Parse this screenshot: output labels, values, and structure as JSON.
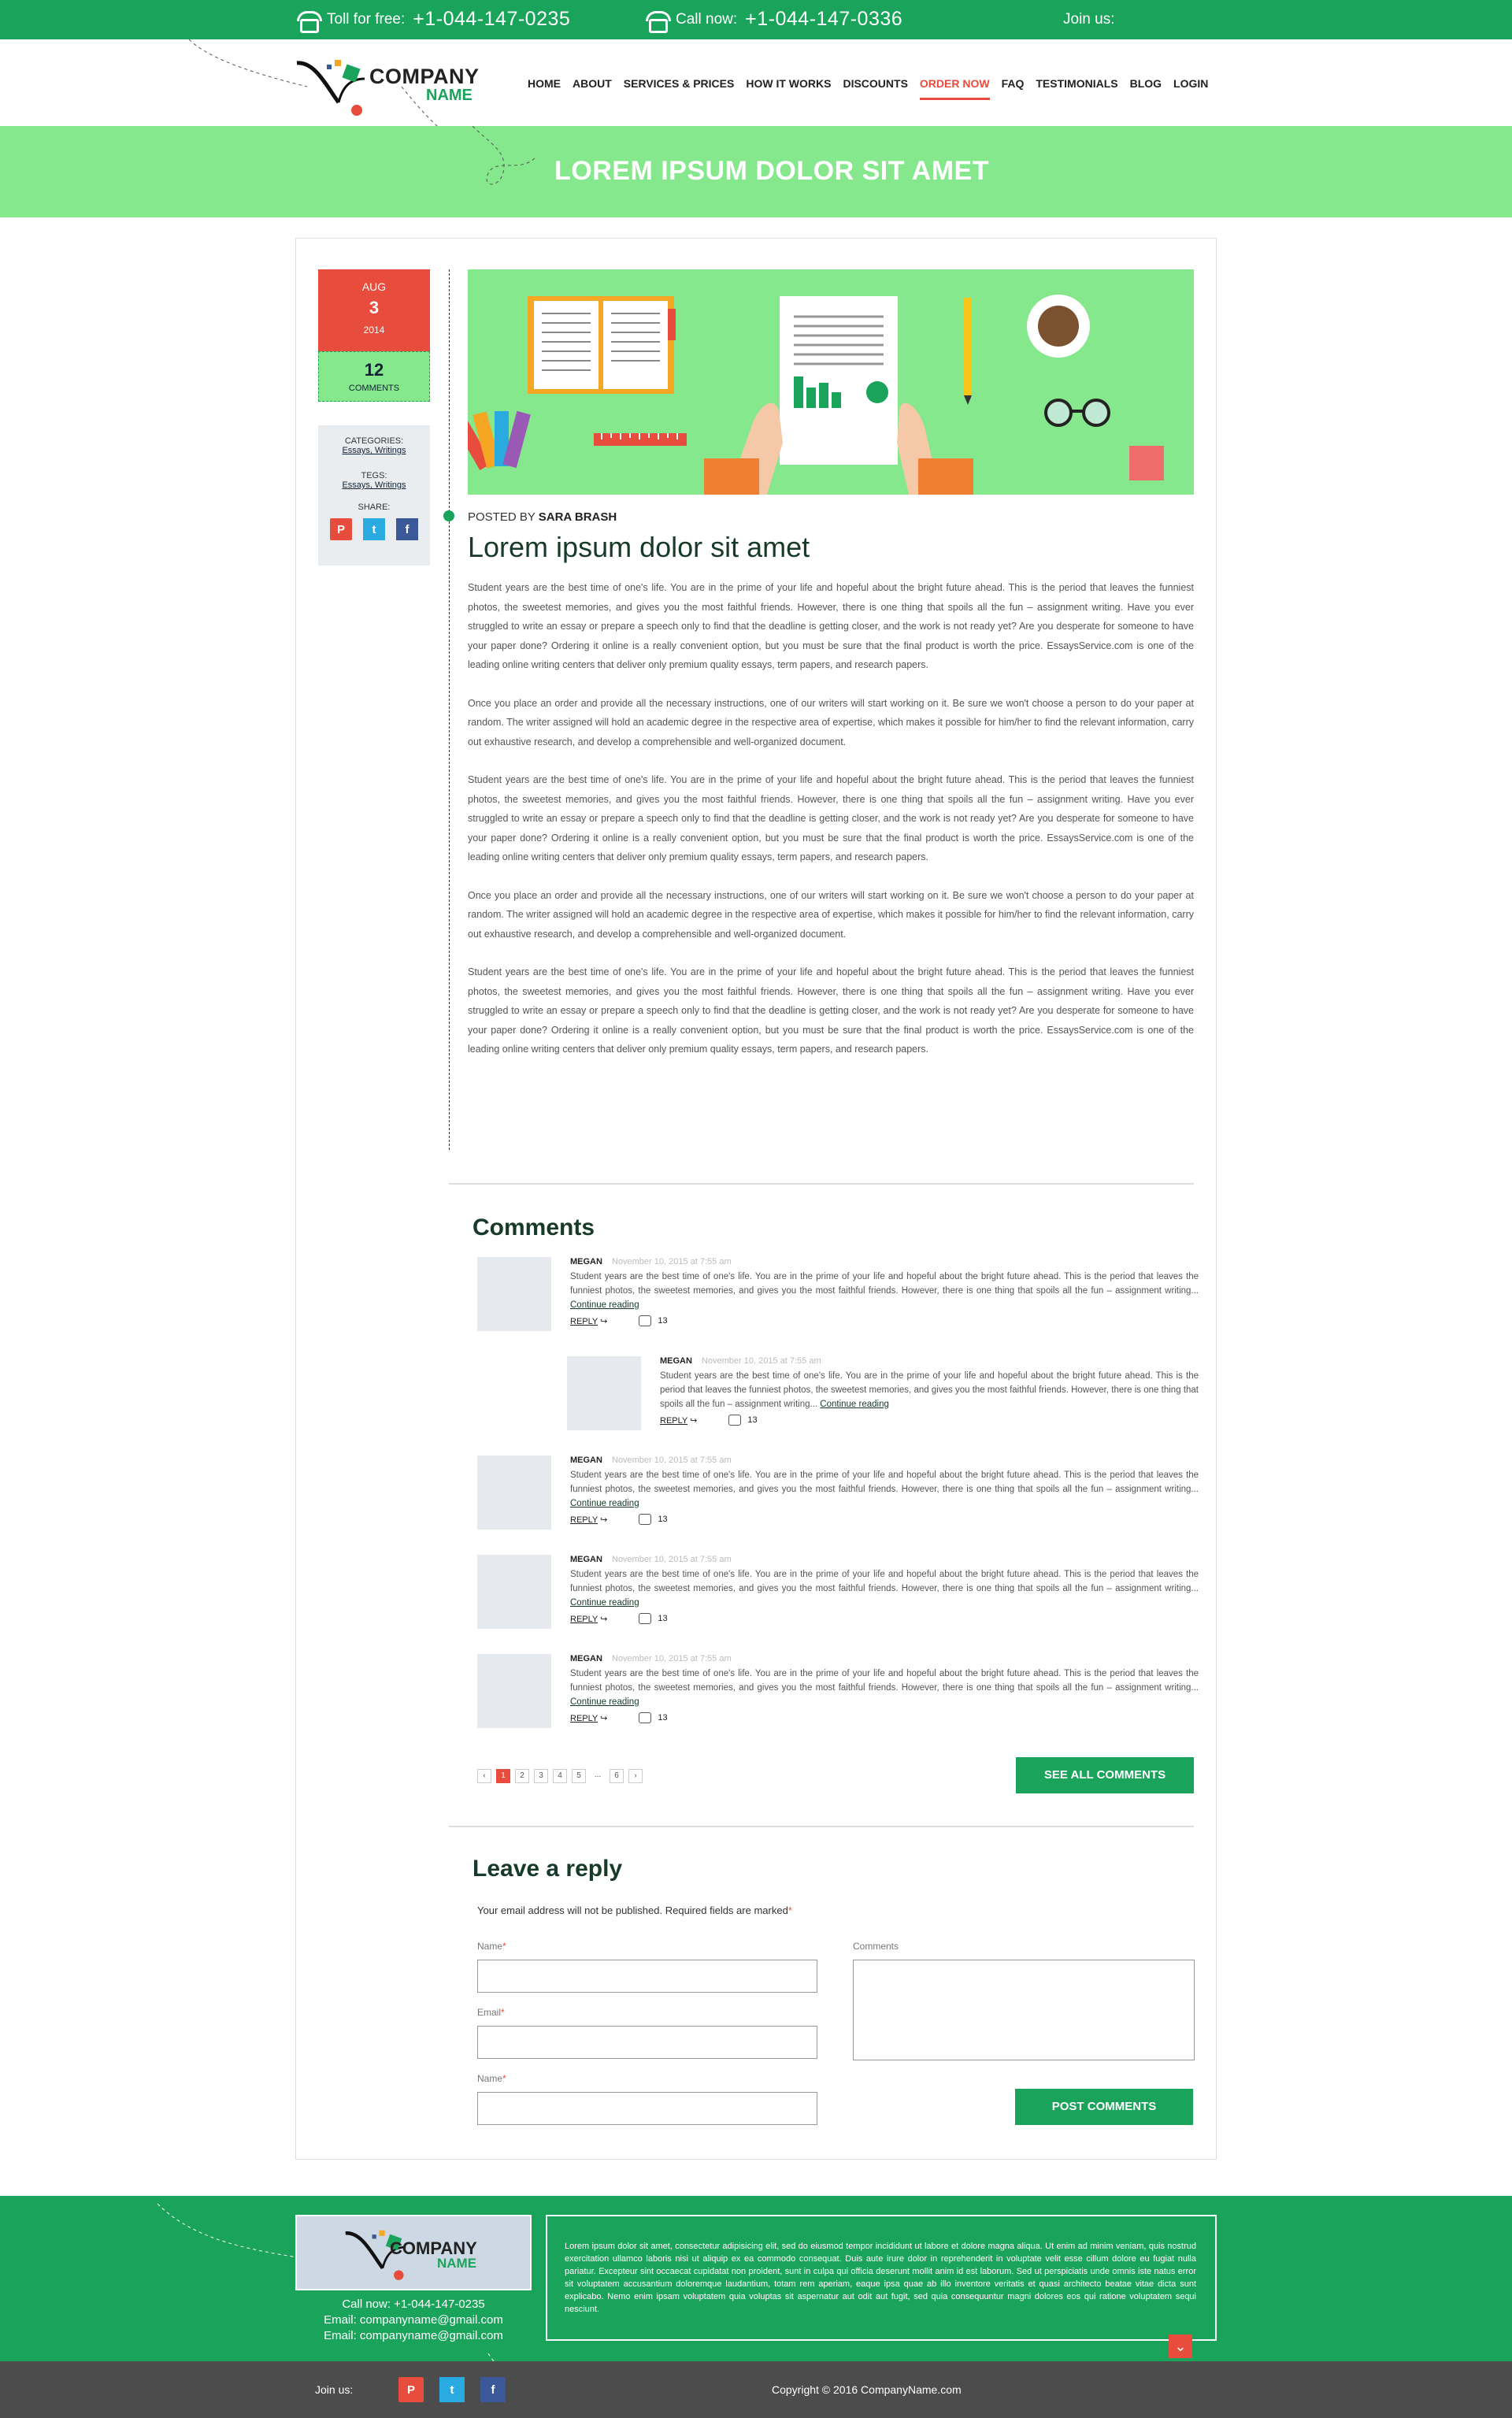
{
  "topbar": {
    "toll_label": "Toll for free:",
    "toll_number": "+1-044-147-0235",
    "call_label": "Call now:",
    "call_number": "+1-044-147-0336",
    "join": "Join us:"
  },
  "logo": {
    "line1": "COMPANY",
    "line2": "NAME"
  },
  "nav": [
    "HOME",
    "ABOUT",
    "SERVICES & PRICES",
    "HOW IT WORKS",
    "DISCOUNTS",
    "ORDER NOW",
    "FAQ",
    "TESTIMONIALS",
    "BLOG",
    "LOGIN"
  ],
  "nav_active": "ORDER NOW",
  "banner_title": "LOREM IPSUM DOLOR SIT AMET",
  "date": {
    "month": "AUG",
    "day": "3",
    "year": "2014",
    "comments_count": "12",
    "comments_label": "COMMENTS"
  },
  "sidebar": {
    "categories_label": "CATEGORIES:",
    "categories_value": "Essays, Writings",
    "tags_label": "TEGS:",
    "tags_value": "Essays, Writings",
    "share_label": "SHARE:"
  },
  "post": {
    "posted_by": "POSTED BY",
    "author": "SARA BRASH",
    "title": "Lorem ipsum dolor sit amet",
    "paragraphs": [
      "Student years are the best time of one's life. You are in the prime of your life and hopeful about the bright future ahead. This is the period that leaves the funniest photos, the sweetest memories, and gives you the most faithful friends. However, there is one thing that spoils all the fun – assignment writing. Have you ever struggled to write an essay or prepare a speech only to find that the deadline is getting closer, and the work is not ready yet? Are you desperate for someone to have your paper done? Ordering it online is a really convenient option, but you must be sure that the final product is worth the price. EssaysService.com is one of the leading online writing centers that deliver only premium quality essays, term papers, and research papers.",
      "Once you place an order and provide all the necessary instructions, one of our writers will start working on it. Be sure we won't choose a person to do your paper at random. The writer assigned will hold an academic degree in the respective area of expertise, which makes it possible for him/her to find the relevant information, carry out exhaustive research, and develop a comprehensible and well-organized document.",
      "Student years are the best time of one's life. You are in the prime of your life and hopeful about the bright future ahead. This is the period that leaves the funniest photos, the sweetest memories, and gives you the most faithful friends. However, there is one thing that spoils all the fun – assignment writing. Have you ever struggled to write an essay or prepare a speech only to find that the deadline is getting closer, and the work is not ready yet? Are you desperate for someone to have your paper done? Ordering it online is a really convenient option, but you must be sure that the final product is worth the price. EssaysService.com is one of the leading online writing centers that deliver only premium quality essays, term papers, and research papers.",
      "Once you place an order and provide all the necessary instructions, one of our writers will start working on it. Be sure we won't choose a person to do your paper at random. The writer assigned will hold an academic degree in the respective area of expertise, which makes it possible for him/her to find the relevant information, carry out exhaustive research, and develop a comprehensible and well-organized document.",
      "Student years are the best time of one's life. You are in the prime of your life and hopeful about the bright future ahead. This is the period that leaves the funniest photos, the sweetest memories, and gives you the most faithful friends. However, there is one thing that spoils all the fun – assignment writing. Have you ever struggled to write an essay or prepare a speech only to find that the deadline is getting closer, and the work is not ready yet? Are you desperate for someone to have your paper done? Ordering it online is a really convenient option, but you must be sure that the final product is worth the price. EssaysService.com is one of the leading online writing centers that deliver only premium quality essays, term papers, and research papers."
    ]
  },
  "comments": {
    "title": "Comments",
    "items": [
      {
        "name": "MEGAN",
        "date": "November 10, 2015 at 7:55 am",
        "text": "Student years are the best time of one's life. You are in the prime of your life and hopeful about the bright future ahead. This is the period that leaves the funniest photos, the sweetest memories, and gives you the most faithful friends. However, there is one thing that spoils all the fun – assignment writing...",
        "more": "Continue reading",
        "reply": "REPLY",
        "likes": "13"
      },
      {
        "name": "MEGAN",
        "date": "November 10, 2015 at 7:55 am",
        "text": "Student years are the best time of one's life. You are in the prime of your life and hopeful about the bright future ahead. This is the period that leaves the funniest photos, the sweetest memories, and gives you the most faithful friends. However, there is one thing that spoils all the fun – assignment writing...",
        "more": "Continue reading",
        "reply": "REPLY",
        "likes": "13"
      },
      {
        "name": "MEGAN",
        "date": "November 10, 2015 at 7:55 am",
        "text": "Student years are the best time of one's life. You are in the prime of your life and hopeful about the bright future ahead. This is the period that leaves the funniest photos, the sweetest memories, and gives you the most faithful friends. However, there is one thing that spoils all the fun – assignment writing...",
        "more": "Continue reading",
        "reply": "REPLY",
        "likes": "13"
      },
      {
        "name": "MEGAN",
        "date": "November 10, 2015 at 7:55 am",
        "text": "Student years are the best time of one's life. You are in the prime of your life and hopeful about the bright future ahead. This is the period that leaves the funniest photos, the sweetest memories, and gives you the most faithful friends. However, there is one thing that spoils all the fun – assignment writing...",
        "more": "Continue reading",
        "reply": "REPLY",
        "likes": "13"
      },
      {
        "name": "MEGAN",
        "date": "November 10, 2015 at 7:55 am",
        "text": "Student years are the best time of one's life. You are in the prime of your life and hopeful about the bright future ahead. This is the period that leaves the funniest photos, the sweetest memories, and gives you the most faithful friends. However, there is one thing that spoils all the fun – assignment writing...",
        "more": "Continue reading",
        "reply": "REPLY",
        "likes": "13"
      }
    ],
    "pager": {
      "prev": "‹",
      "pages": [
        "1",
        "2",
        "3",
        "4",
        "5"
      ],
      "ellipsis": "...",
      "last": "6",
      "next": "›",
      "current": "1"
    },
    "see_all": "SEE ALL COMMENTS"
  },
  "reply": {
    "title": "Leave a reply",
    "note": "Your email address will not be published. Required fields are marked",
    "note_mark": "*",
    "name_label": "Name",
    "email_label": "Email",
    "name2_label": "Name",
    "comments_label": "Comments",
    "required": "*",
    "submit": "POST COMMENTS"
  },
  "footer": {
    "logo_line1": "COMPANY",
    "logo_line2": "NAME",
    "call": "Call now: +1-044-147-0235",
    "email1": "Email: companyname@gmail.com",
    "email2": "Email: companyname@gmail.com",
    "about": "Lorem ipsum dolor sit amet, consectetur adipisicing elit, sed do eiusmod tempor incididunt ut labore et dolore magna aliqua. Ut enim ad minim veniam, quis nostrud exercitation ullamco laboris nisi ut aliquip ex ea commodo consequat. Duis aute irure dolor in reprehenderit in voluptate velit esse cillum dolore eu fugiat nulla pariatur. Excepteur sint occaecat cupidatat non proident, sunt in culpa qui officia deserunt mollit anim id est laborum. Sed ut perspiciatis unde omnis iste natus error sit voluptatem accusantium doloremque laudantium, totam rem aperiam, eaque ipsa quae ab illo inventore veritatis et quasi architecto beatae vitae dicta sunt explicabo. Nemo enim ipsam voluptatem quia voluptas sit aspernatur aut odit aut fugit, sed quia consequuntur magni dolores eos qui ratione voluptatem sequi nesciunt.",
    "down_icon": "chevron-down-icon",
    "join": "Join us:",
    "copyright": "Copyright © 2016 CompanyName.com"
  },
  "colors": {
    "green": "#1aa35a",
    "light_green": "#85e88c",
    "red": "#e74c3c",
    "dark": "#4c4c4c"
  }
}
